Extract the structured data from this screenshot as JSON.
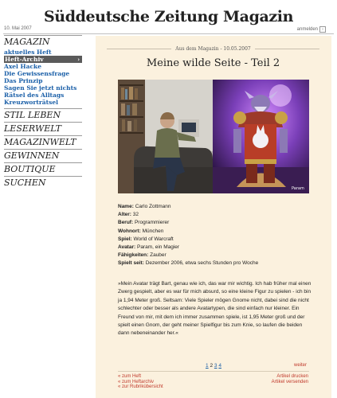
{
  "masthead": "Süddeutsche Zeitung Magazin",
  "header": {
    "date": "10. Mai 2007",
    "logout": "anmelden"
  },
  "nav": {
    "magazin": "MAGAZIN",
    "magazin_items": [
      {
        "label": "aktuelles Heft"
      },
      {
        "label": "Heft-Archiv",
        "arrow": "›"
      },
      {
        "label": "Axel Hacke"
      },
      {
        "label": "Die Gewissensfrage"
      },
      {
        "label": "Das Prinzip"
      },
      {
        "label": "Sagen Sie jetzt nichts"
      },
      {
        "label": "Rätsel des Alltags"
      },
      {
        "label": "Kreuzworträtsel"
      }
    ],
    "sections": [
      "STIL LEBEN",
      "LESERWELT",
      "MAGAZINWELT",
      "GEWINNEN",
      "BOUTIQUE",
      "SUCHEN"
    ]
  },
  "article": {
    "issue": "Aus dem Magazin - 10.05.2007",
    "title": "Meine wilde Seite - Teil 2",
    "facts": [
      {
        "k": "Name:",
        "v": "Carlo Zottmann"
      },
      {
        "k": "Alter:",
        "v": "32"
      },
      {
        "k": "Beruf:",
        "v": "Programmierer"
      },
      {
        "k": "Wohnort:",
        "v": "München"
      },
      {
        "k": "Spiel:",
        "v": "World of Warcraft"
      },
      {
        "k": "Avatar:",
        "v": "Param, ein Magier"
      },
      {
        "k": "Fähigkeiten:",
        "v": "Zauber"
      },
      {
        "k": "Spielt seit:",
        "v": "Dezember 2006, etwa sechs Stunden pro Woche"
      }
    ],
    "quote": "»Mein Avatar trägt Bart, genau wie ich, das war mir wichtig. Ich hab früher mal einen Zwerg gespielt, aber es war für mich absurd, so eine kleine Figur zu spielen - ich bin ja 1,94 Meter groß. Seltsam: Viele Spieler mögen Gnome nicht, dabei sind die nicht schlechter oder besser als andere Avatartypen, die sind einfach nur kleiner. Ein Freund von mir, mit dem ich immer zusammen spiele, ist 1,95 Meter groß und der spielt einen Gnom, der geht meiner Spielfigur bis zum Knie, so laufen die beiden dann nebeneinander her.«",
    "photo_credit": "Param"
  },
  "pager": {
    "pages": [
      "1",
      "2",
      "3",
      "4"
    ],
    "current": "2",
    "next": "weiter"
  },
  "footer": {
    "left": [
      "« zum Heft",
      "« zum Heftarchiv",
      "« zur Rubrikübersicht"
    ],
    "right": [
      "Artikel drucken",
      "Artikel versenden"
    ]
  }
}
